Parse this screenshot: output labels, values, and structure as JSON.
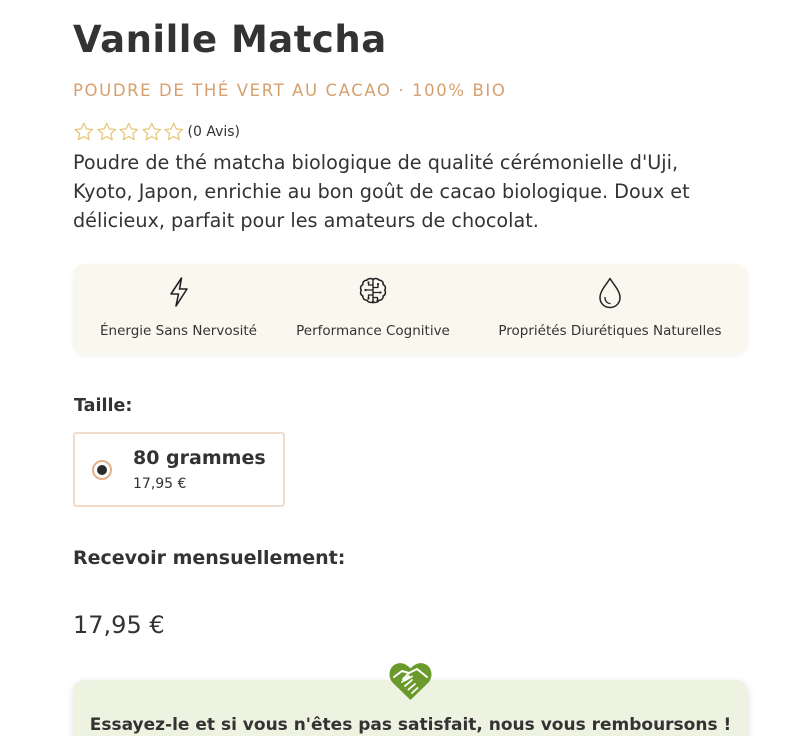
{
  "product": {
    "title": "Vanille Matcha",
    "subtitle": "POUDRE DE THÉ VERT AU CACAO · 100% BIO",
    "rating": {
      "stars_filled": 0,
      "stars_total": 5,
      "text": "(0 Avis)"
    },
    "description": "Poudre de thé matcha biologique de qualité cérémonielle d'Uji, Kyoto, Japon, enrichie au bon goût de cacao biologique. Doux et délicieux, parfait pour les amateurs de chocolat."
  },
  "features": [
    {
      "icon": "lightning-icon",
      "label": "Énergie Sans Nervosité"
    },
    {
      "icon": "brain-icon",
      "label": "Performance Cognitive"
    },
    {
      "icon": "water-drop-icon",
      "label": "Propriétés Diurétiques Naturelles"
    }
  ],
  "size": {
    "label": "Taille:",
    "options": [
      {
        "name": "80 grammes",
        "price": "17,95 €",
        "selected": true
      }
    ]
  },
  "subscription": {
    "label": "Recevoir mensuellement:"
  },
  "price": "17,95 €",
  "guarantee": {
    "icon": "heart-handshake-icon",
    "text": "Essayez-le et si vous n'êtes pas satisfait, nous vous remboursons !"
  },
  "colors": {
    "accent": "#d6a06e",
    "star": "#e7c77a",
    "features_bg": "#faf7ef",
    "guarantee_bg": "#eef2e1",
    "icon_green": "#6a9a2c"
  }
}
